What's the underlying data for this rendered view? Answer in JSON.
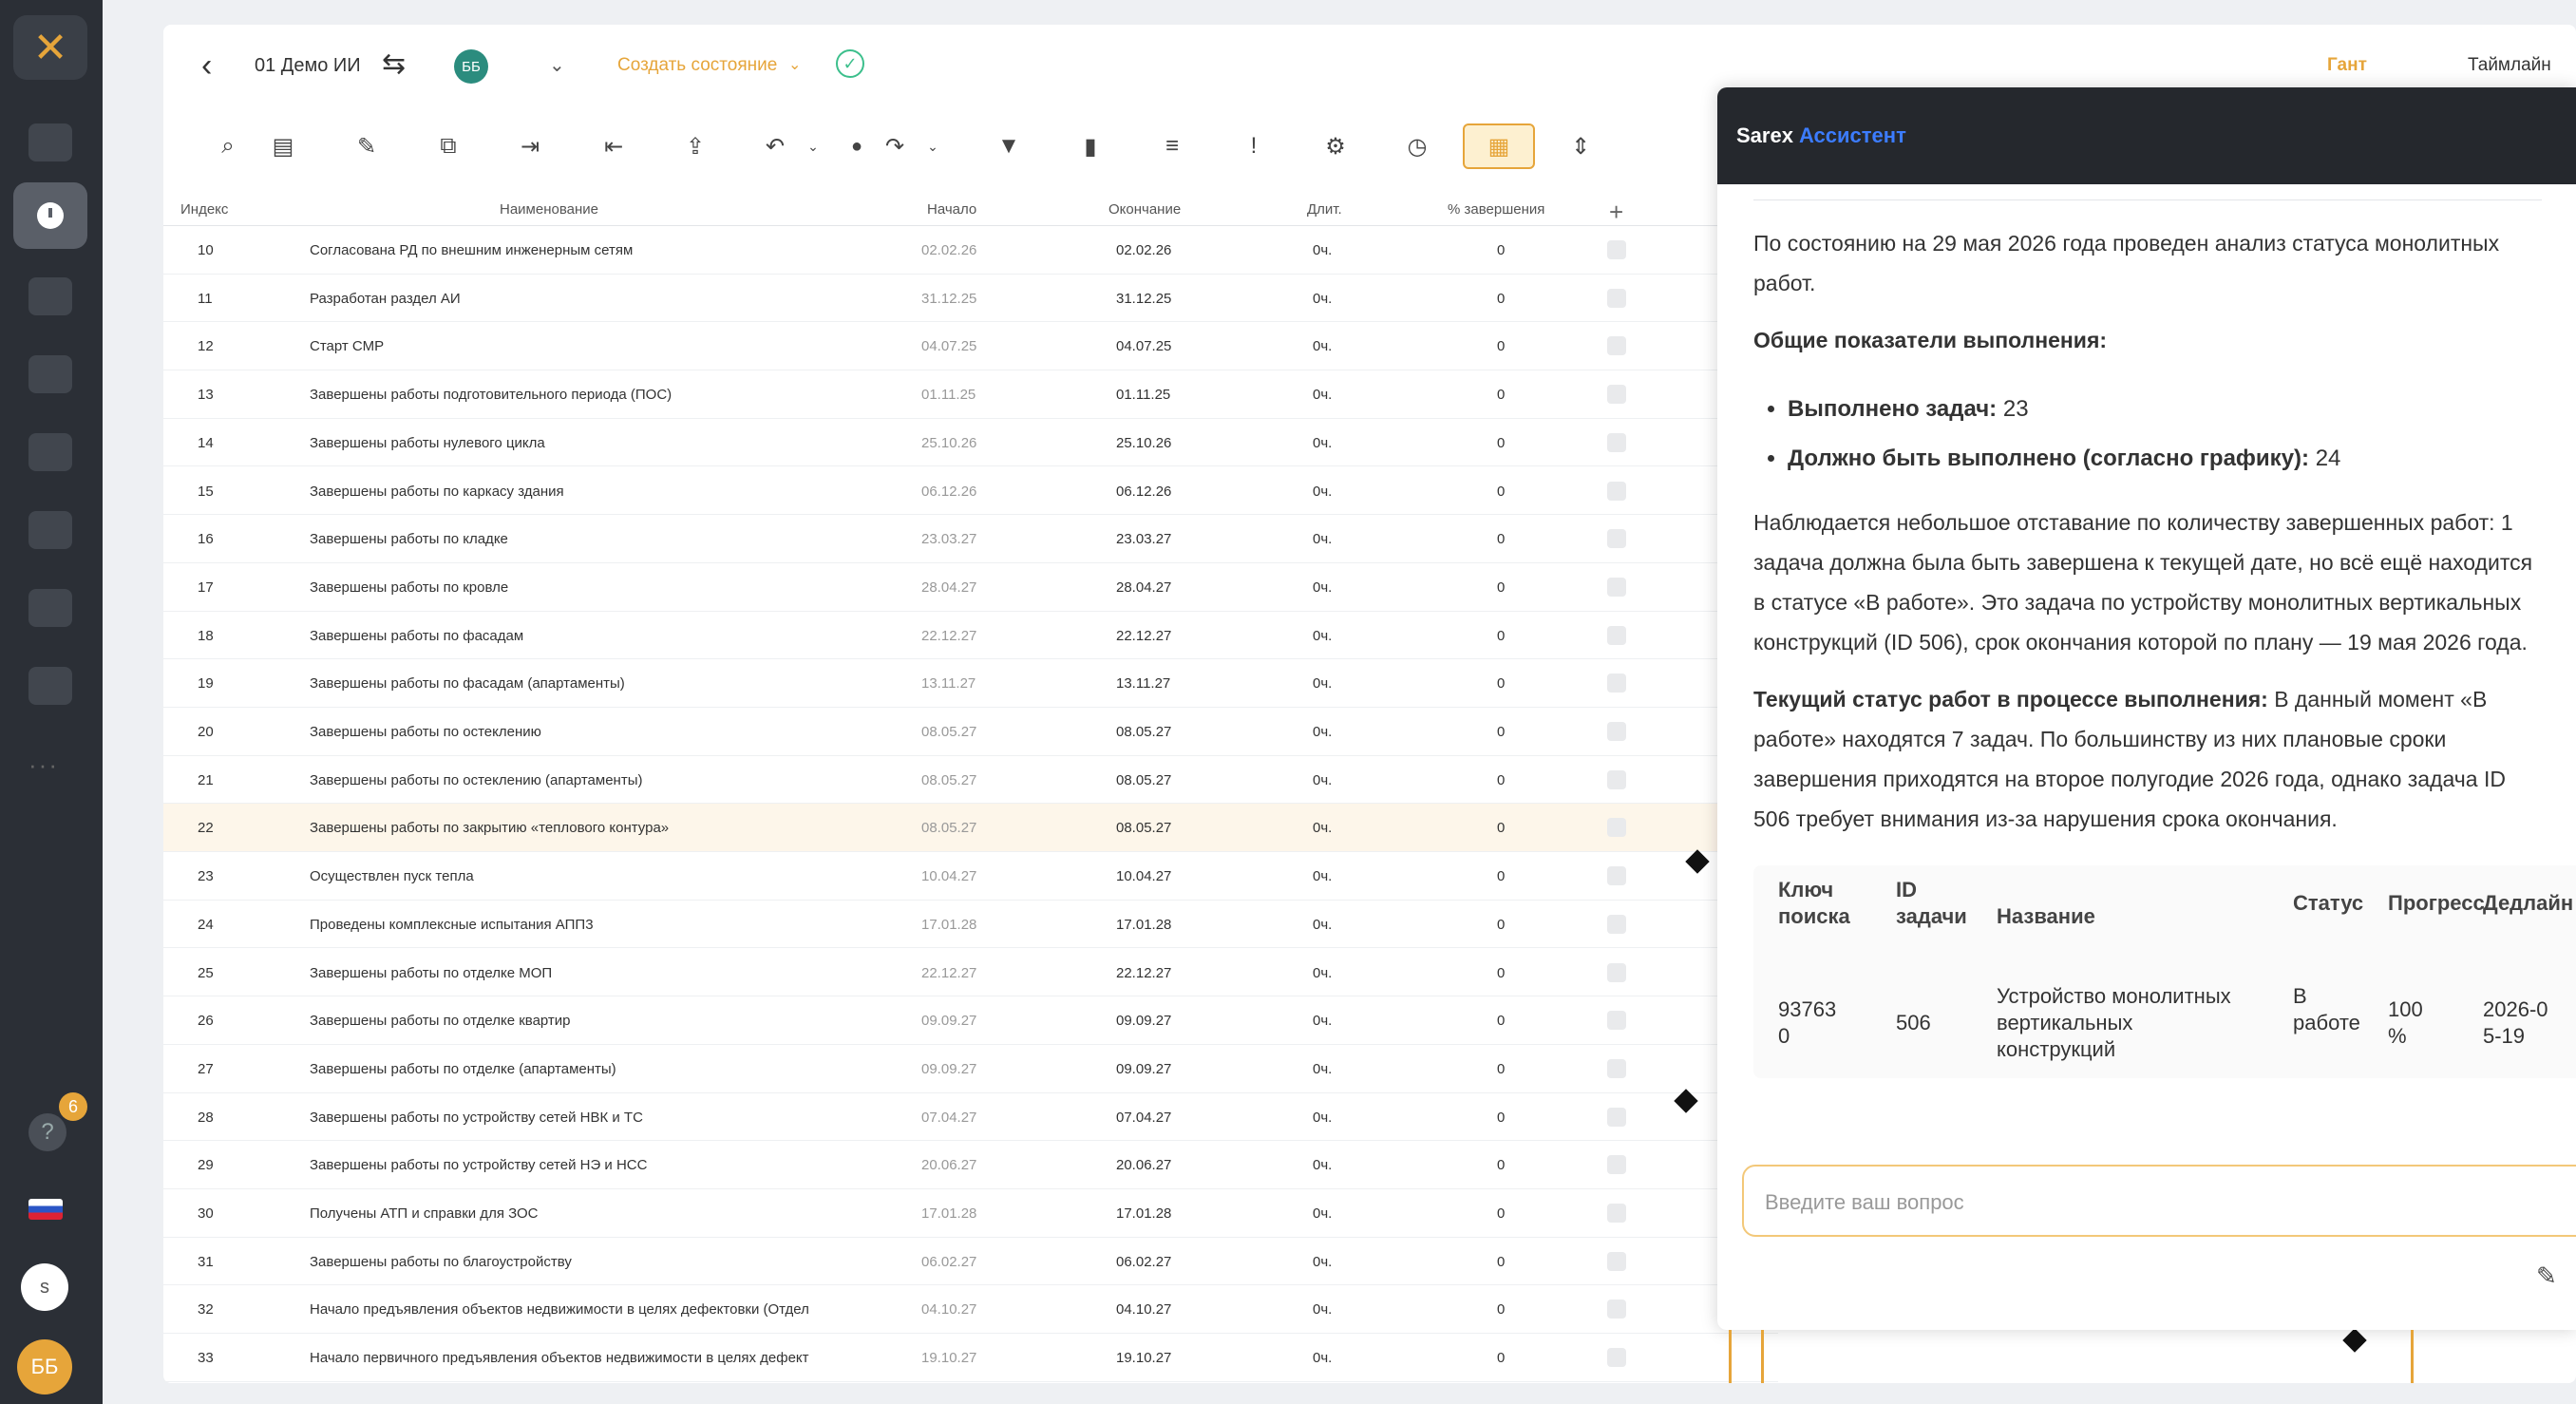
{
  "app": {
    "project": "01 Демо ИИ",
    "user_initials": "ББ",
    "create_state": "Создать состояние",
    "view_gantt": "Гант",
    "view_timeline": "Таймлайн",
    "accent_color": "#e6a53a",
    "brand_color": "#3c7cff"
  },
  "rail": {
    "notifications_count": "6",
    "user_short": "s",
    "avatar_initials": "ББ",
    "more": "···"
  },
  "toolbar_icons": [
    "search-icon",
    "clipboard-icon",
    "pencil-icon",
    "copy-icon",
    "indent-icon",
    "outdent-icon",
    "export-icon",
    "undo-icon",
    "info-icon",
    "redo-icon",
    "filter-icon",
    "bookmark-icon",
    "align-icon",
    "alert-icon",
    "user-settings-icon",
    "clock-icon",
    "table-icon",
    "expand-icon"
  ],
  "table": {
    "headers": {
      "index": "Индекс",
      "name": "Наименование",
      "start": "Начало",
      "end": "Окончание",
      "duration": "Длит.",
      "percent": "% завершения",
      "add": "+"
    },
    "rows": [
      {
        "idx": "10",
        "name": "Согласована РД по внешним инженерным сетям",
        "start": "02.02.26",
        "end": "02.02.26",
        "dur": "0ч.",
        "pct": "0"
      },
      {
        "idx": "11",
        "name": "Разработан раздел АИ",
        "start": "31.12.25",
        "end": "31.12.25",
        "dur": "0ч.",
        "pct": "0"
      },
      {
        "idx": "12",
        "name": "Старт СМР",
        "start": "04.07.25",
        "end": "04.07.25",
        "dur": "0ч.",
        "pct": "0"
      },
      {
        "idx": "13",
        "name": "Завершены работы подготовительного периода (ПОС)",
        "start": "01.11.25",
        "end": "01.11.25",
        "dur": "0ч.",
        "pct": "0"
      },
      {
        "idx": "14",
        "name": "Завершены работы нулевого цикла",
        "start": "25.10.26",
        "end": "25.10.26",
        "dur": "0ч.",
        "pct": "0"
      },
      {
        "idx": "15",
        "name": "Завершены работы по каркасу здания",
        "start": "06.12.26",
        "end": "06.12.26",
        "dur": "0ч.",
        "pct": "0"
      },
      {
        "idx": "16",
        "name": "Завершены работы по кладке",
        "start": "23.03.27",
        "end": "23.03.27",
        "dur": "0ч.",
        "pct": "0"
      },
      {
        "idx": "17",
        "name": "Завершены работы по кровле",
        "start": "28.04.27",
        "end": "28.04.27",
        "dur": "0ч.",
        "pct": "0"
      },
      {
        "idx": "18",
        "name": "Завершены работы по фасадам",
        "start": "22.12.27",
        "end": "22.12.27",
        "dur": "0ч.",
        "pct": "0"
      },
      {
        "idx": "19",
        "name": "Завершены работы по фасадам (апартаменты)",
        "start": "13.11.27",
        "end": "13.11.27",
        "dur": "0ч.",
        "pct": "0"
      },
      {
        "idx": "20",
        "name": "Завершены работы по остеклению",
        "start": "08.05.27",
        "end": "08.05.27",
        "dur": "0ч.",
        "pct": "0"
      },
      {
        "idx": "21",
        "name": "Завершены работы по остеклению (апартаменты)",
        "start": "08.05.27",
        "end": "08.05.27",
        "dur": "0ч.",
        "pct": "0"
      },
      {
        "idx": "22",
        "name": "Завершены работы по закрытию «теплового контура»",
        "start": "08.05.27",
        "end": "08.05.27",
        "dur": "0ч.",
        "pct": "0"
      },
      {
        "idx": "23",
        "name": "Осуществлен пуск тепла",
        "start": "10.04.27",
        "end": "10.04.27",
        "dur": "0ч.",
        "pct": "0"
      },
      {
        "idx": "24",
        "name": "Проведены комплексные испытания АПП3",
        "start": "17.01.28",
        "end": "17.01.28",
        "dur": "0ч.",
        "pct": "0"
      },
      {
        "idx": "25",
        "name": "Завершены работы по отделке МОП",
        "start": "22.12.27",
        "end": "22.12.27",
        "dur": "0ч.",
        "pct": "0"
      },
      {
        "idx": "26",
        "name": "Завершены работы по отделке квартир",
        "start": "09.09.27",
        "end": "09.09.27",
        "dur": "0ч.",
        "pct": "0"
      },
      {
        "idx": "27",
        "name": "Завершены работы по отделке (апартаменты)",
        "start": "09.09.27",
        "end": "09.09.27",
        "dur": "0ч.",
        "pct": "0"
      },
      {
        "idx": "28",
        "name": "Завершены работы по устройству сетей НВК и ТС",
        "start": "07.04.27",
        "end": "07.04.27",
        "dur": "0ч.",
        "pct": "0"
      },
      {
        "idx": "29",
        "name": "Завершены работы по устройству сетей НЭ и НСС",
        "start": "20.06.27",
        "end": "20.06.27",
        "dur": "0ч.",
        "pct": "0"
      },
      {
        "idx": "30",
        "name": "Получены АТП и справки для ЗОС",
        "start": "17.01.28",
        "end": "17.01.28",
        "dur": "0ч.",
        "pct": "0"
      },
      {
        "idx": "31",
        "name": "Завершены работы по благоустройству",
        "start": "06.02.27",
        "end": "06.02.27",
        "dur": "0ч.",
        "pct": "0"
      },
      {
        "idx": "32",
        "name": "Начало предъявления объектов недвижимости в целях дефектовки (Отдел",
        "start": "04.10.27",
        "end": "04.10.27",
        "dur": "0ч.",
        "pct": "0"
      },
      {
        "idx": "33",
        "name": "Начало первичного предъявления объектов недвижимости в целях дефект",
        "start": "19.10.27",
        "end": "19.10.27",
        "dur": "0ч.",
        "pct": "0"
      }
    ]
  },
  "assistant": {
    "brand": "Sarex",
    "title": "Ассистент",
    "intro": "По состоянию на 29 мая 2026 года проведен анализ статуса монолитных работ.",
    "metrics_heading": "Общие показатели выполнения:",
    "metrics": [
      {
        "label": "Выполнено задач:",
        "value": "23"
      },
      {
        "label": "Должно быть выполнено (согласно графику):",
        "value": "24"
      }
    ],
    "lag_text": "Наблюдается небольшое отставание по количеству завершенных работ: 1 задача должна была быть завершена к текущей дате, но всё ещё находится в статусе «В работе». Это задача по устройству монолитных вертикальных конструкций (ID 506), срок окончания которой по плану — 19 мая 2026 года.",
    "current_heading": "Текущий статус работ в процессе выполнения:",
    "current_text": "В данный момент «В работе» находятся 7 задач. По большинству из них плановые сроки завершения приходятся на второе полугодие 2026 года, однако задача ID 506 требует внимания из-за нарушения срока окончания.",
    "table_headers": {
      "key": "Ключ поиска",
      "id": "ID задачи",
      "name": "Название",
      "status": "Статус",
      "progress": "Прогресс",
      "deadline": "Дедлайн"
    },
    "table_row": {
      "key": "937630",
      "id": "506",
      "name": "Устройство монолитных вертикальных конструкций",
      "status": "В работе",
      "progress": "100 %",
      "deadline": "2026-05-19"
    },
    "input_placeholder": "Введите ваш вопрос"
  }
}
